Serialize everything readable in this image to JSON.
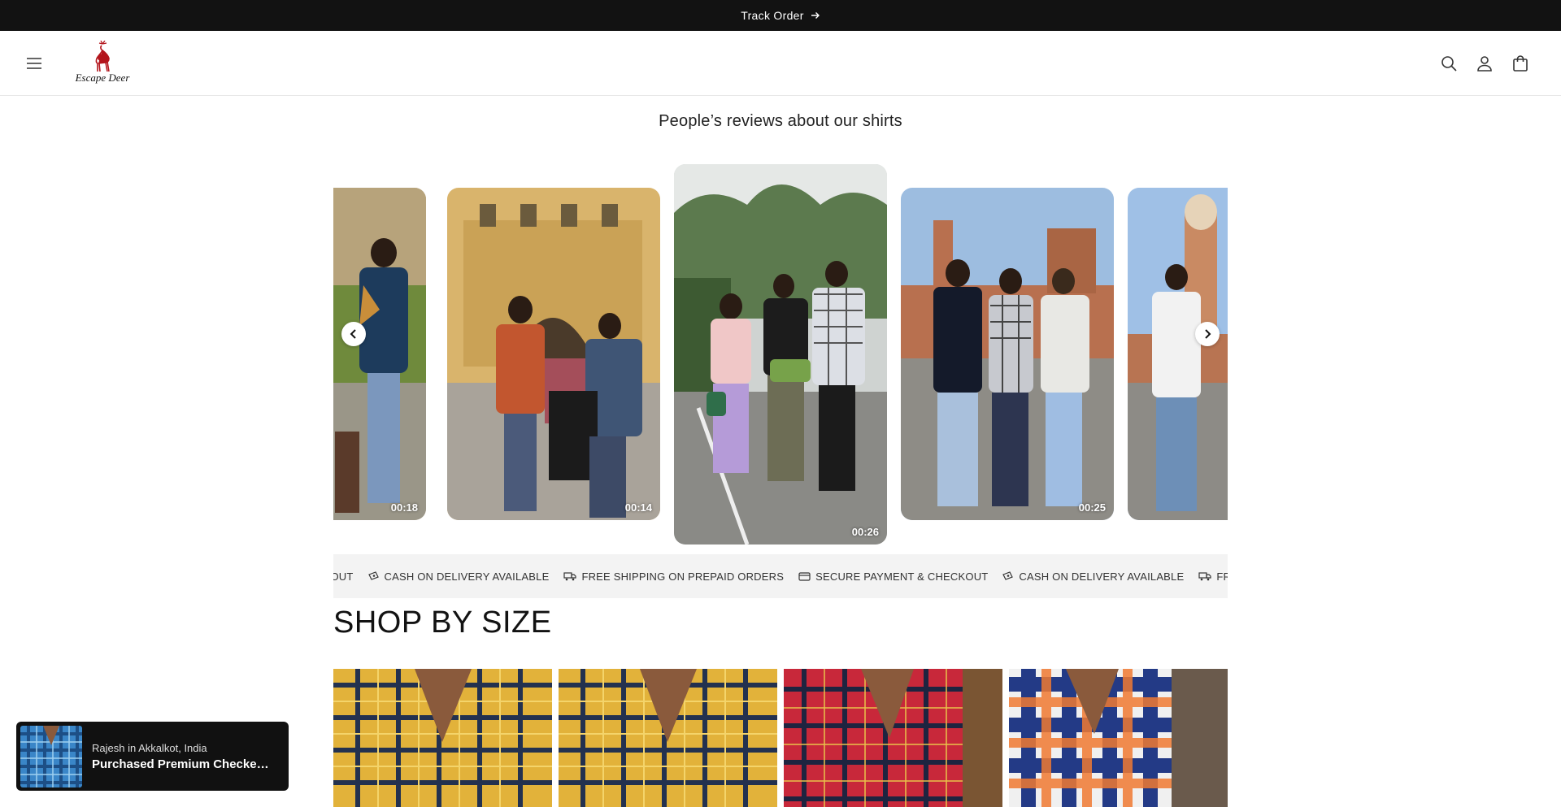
{
  "announcement": {
    "text": "Track Order"
  },
  "header": {
    "logo_text": "Escape Deer",
    "icons": [
      "menu-icon",
      "search-icon",
      "account-icon",
      "cart-icon"
    ]
  },
  "reviews": {
    "title": "People’s reviews about our shirts",
    "videos": [
      {
        "duration": "00:18"
      },
      {
        "duration": "00:14"
      },
      {
        "duration": "00:26"
      },
      {
        "duration": "00:25"
      }
    ]
  },
  "marquee": {
    "items": [
      {
        "icon": "lock-card-icon",
        "text": "CKOUT"
      },
      {
        "icon": "cash-icon",
        "text": "CASH ON DELIVERY AVAILABLE"
      },
      {
        "icon": "truck-icon",
        "text": "FREE SHIPPING ON PREPAID ORDERS"
      },
      {
        "icon": "card-icon",
        "text": "SECURE PAYMENT & CHECKOUT"
      },
      {
        "icon": "cash-icon",
        "text": "CASH ON DELIVERY AVAILABLE"
      },
      {
        "icon": "truck-icon",
        "text": "FREE SHIPPING ON PREPAID ORDERS"
      }
    ]
  },
  "shop_by_size": {
    "title": "SHOP BY SIZE"
  },
  "toast": {
    "location": "Rajesh in Akkalkot, India",
    "product": "Purchased Premium Checked Shirt"
  },
  "colors": {
    "topbar": "#121212",
    "marquee_bg": "#f3f3f3",
    "logo_red": "#b3151c"
  }
}
